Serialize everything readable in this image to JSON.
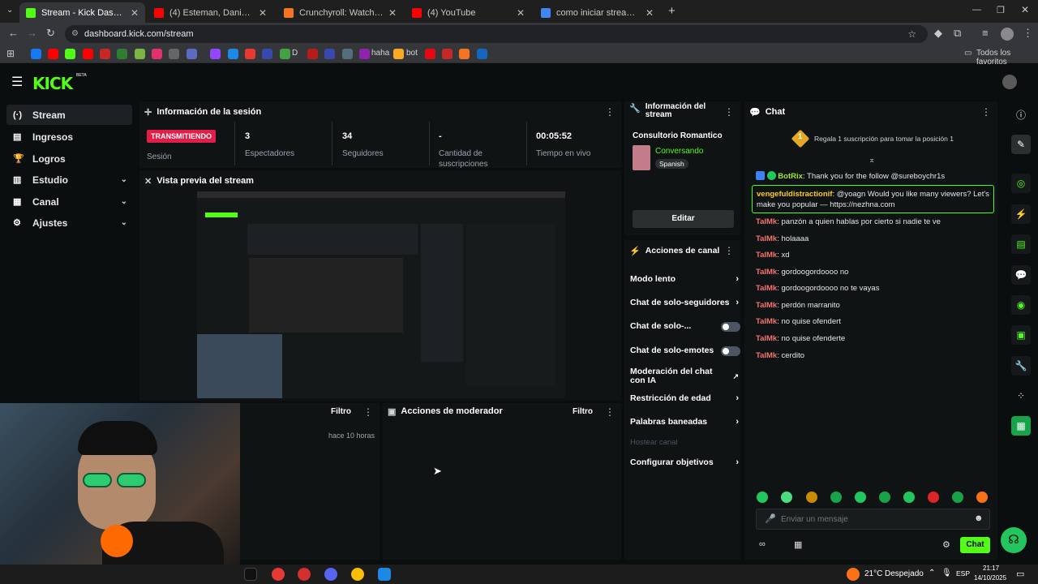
{
  "browser": {
    "tabs": [
      {
        "title": "Stream - Kick Dashboard",
        "favicon_color": "#53fc18",
        "active": true
      },
      {
        "title": "(4) Esteman, Daniela Spalla - Te",
        "favicon_color": "#ff0000",
        "active": false
      },
      {
        "title": "Crunchyroll: Watch Popular An",
        "favicon_color": "#f47521",
        "active": false
      },
      {
        "title": "(4) YouTube",
        "favicon_color": "#ff0000",
        "active": false
      },
      {
        "title": "como iniciar stream en kick - Bú",
        "favicon_color": "#4285f4",
        "active": false
      }
    ],
    "new_tab_label": "+",
    "url": "dashboard.kick.com/stream",
    "bookmarks": {
      "items": [
        "D",
        "haha",
        "bot"
      ],
      "all_favorites_label": "Todos los favoritos"
    }
  },
  "app": {
    "logo_text": "KICK",
    "logo_badge": "BETA",
    "accent_color": "#53fc18"
  },
  "sidebar": {
    "items": [
      {
        "label": "Stream",
        "icon": "broadcast-icon",
        "glyph": "(·)",
        "active": true,
        "expandable": false
      },
      {
        "label": "Ingresos",
        "icon": "money-icon",
        "glyph": "▤",
        "active": false,
        "expandable": false
      },
      {
        "label": "Logros",
        "icon": "trophy-icon",
        "glyph": "🏆",
        "active": false,
        "expandable": false
      },
      {
        "label": "Estudio",
        "icon": "book-icon",
        "glyph": "▥",
        "active": false,
        "expandable": true
      },
      {
        "label": "Canal",
        "icon": "channel-icon",
        "glyph": "▦",
        "active": false,
        "expandable": true
      },
      {
        "label": "Ajustes",
        "icon": "gear-icon",
        "glyph": "⚙",
        "active": false,
        "expandable": true
      }
    ]
  },
  "session": {
    "title": "Información de la sesión",
    "status_badge": "TRANSMITIENDO",
    "status_label": "Sesión",
    "stats": [
      {
        "value": "3",
        "label": "Espectadores"
      },
      {
        "value": "34",
        "label": "Seguidores"
      },
      {
        "value": "-",
        "label": "Cantidad de suscripciones"
      },
      {
        "value": "00:05:52",
        "label": "Tiempo en vivo"
      }
    ]
  },
  "preview": {
    "title": "Vista previa del stream"
  },
  "activity": {
    "filter_label": "Filtro",
    "timestamp": "hace 10 horas"
  },
  "moderator": {
    "title": "Acciones de moderador",
    "filter_label": "Filtro"
  },
  "stream_info": {
    "title": "Información del stream",
    "stream_title": "Consultorio Romantico",
    "category": "Conversando",
    "language_tag": "Spanish",
    "edit_label": "Editar"
  },
  "channel_actions": {
    "title": "Acciones de canal",
    "items": [
      {
        "label": "Modo lento",
        "control": "arrow",
        "enabled": true
      },
      {
        "label": "Chat de solo-seguidores",
        "control": "arrow",
        "enabled": true
      },
      {
        "label": "Chat de solo-...",
        "control": "toggle",
        "enabled": true
      },
      {
        "label": "Chat de solo-emotes",
        "control": "toggle",
        "enabled": true
      },
      {
        "label": "Moderación del chat con IA",
        "control": "external",
        "enabled": true
      },
      {
        "label": "Restricción de edad",
        "control": "arrow",
        "enabled": true
      },
      {
        "label": "Palabras baneadas",
        "control": "arrow",
        "enabled": true
      },
      {
        "label": "Hostear canal",
        "control": "none",
        "enabled": false
      },
      {
        "label": "Configurar objetivos",
        "control": "arrow",
        "enabled": true
      }
    ]
  },
  "chat": {
    "title": "Chat",
    "gift_rank": "1",
    "gift_text": "Regala 1 suscripción para tomar la posición 1",
    "bot_message": {
      "user": "BotRix",
      "text": "Thank you for the follow @sureboychr1s"
    },
    "highlight_message": {
      "user": "vengefuldistractionif",
      "text": "@yoagn Would you like many viewers? Let's make you popular — https://nezhna.com"
    },
    "messages": [
      {
        "user": "TalMk",
        "text": "panzón a quien hablas por cierto si nadie te ve"
      },
      {
        "user": "TalMk",
        "text": "holaaaa"
      },
      {
        "user": "TalMk",
        "text": "xd"
      },
      {
        "user": "TalMk",
        "text": "gordoogordoooo no"
      },
      {
        "user": "TalMk",
        "text": "gordoogordoooo no te vayas"
      },
      {
        "user": "TalMk",
        "text": "perdón marranito"
      },
      {
        "user": "TalMk",
        "text": "no quise ofendert"
      },
      {
        "user": "TalMk",
        "text": "no quise ofenderte"
      },
      {
        "user": "TalMk",
        "text": "cerdito"
      }
    ],
    "input_placeholder": "Enviar un mensaje",
    "send_label": "Chat"
  },
  "right_rail": {
    "items": [
      "info-icon",
      "pencil-icon",
      "target-icon",
      "bolt-icon",
      "clipboard-icon",
      "speech-icon",
      "broadcast-icon",
      "layout-icon",
      "wrench-icon",
      "apps-icon",
      "clapper-icon"
    ]
  },
  "taskbar": {
    "weather_temp": "21°C",
    "weather_text": "Despejado",
    "language": "ESP",
    "time": "21:17",
    "date": "14/10/2025"
  }
}
